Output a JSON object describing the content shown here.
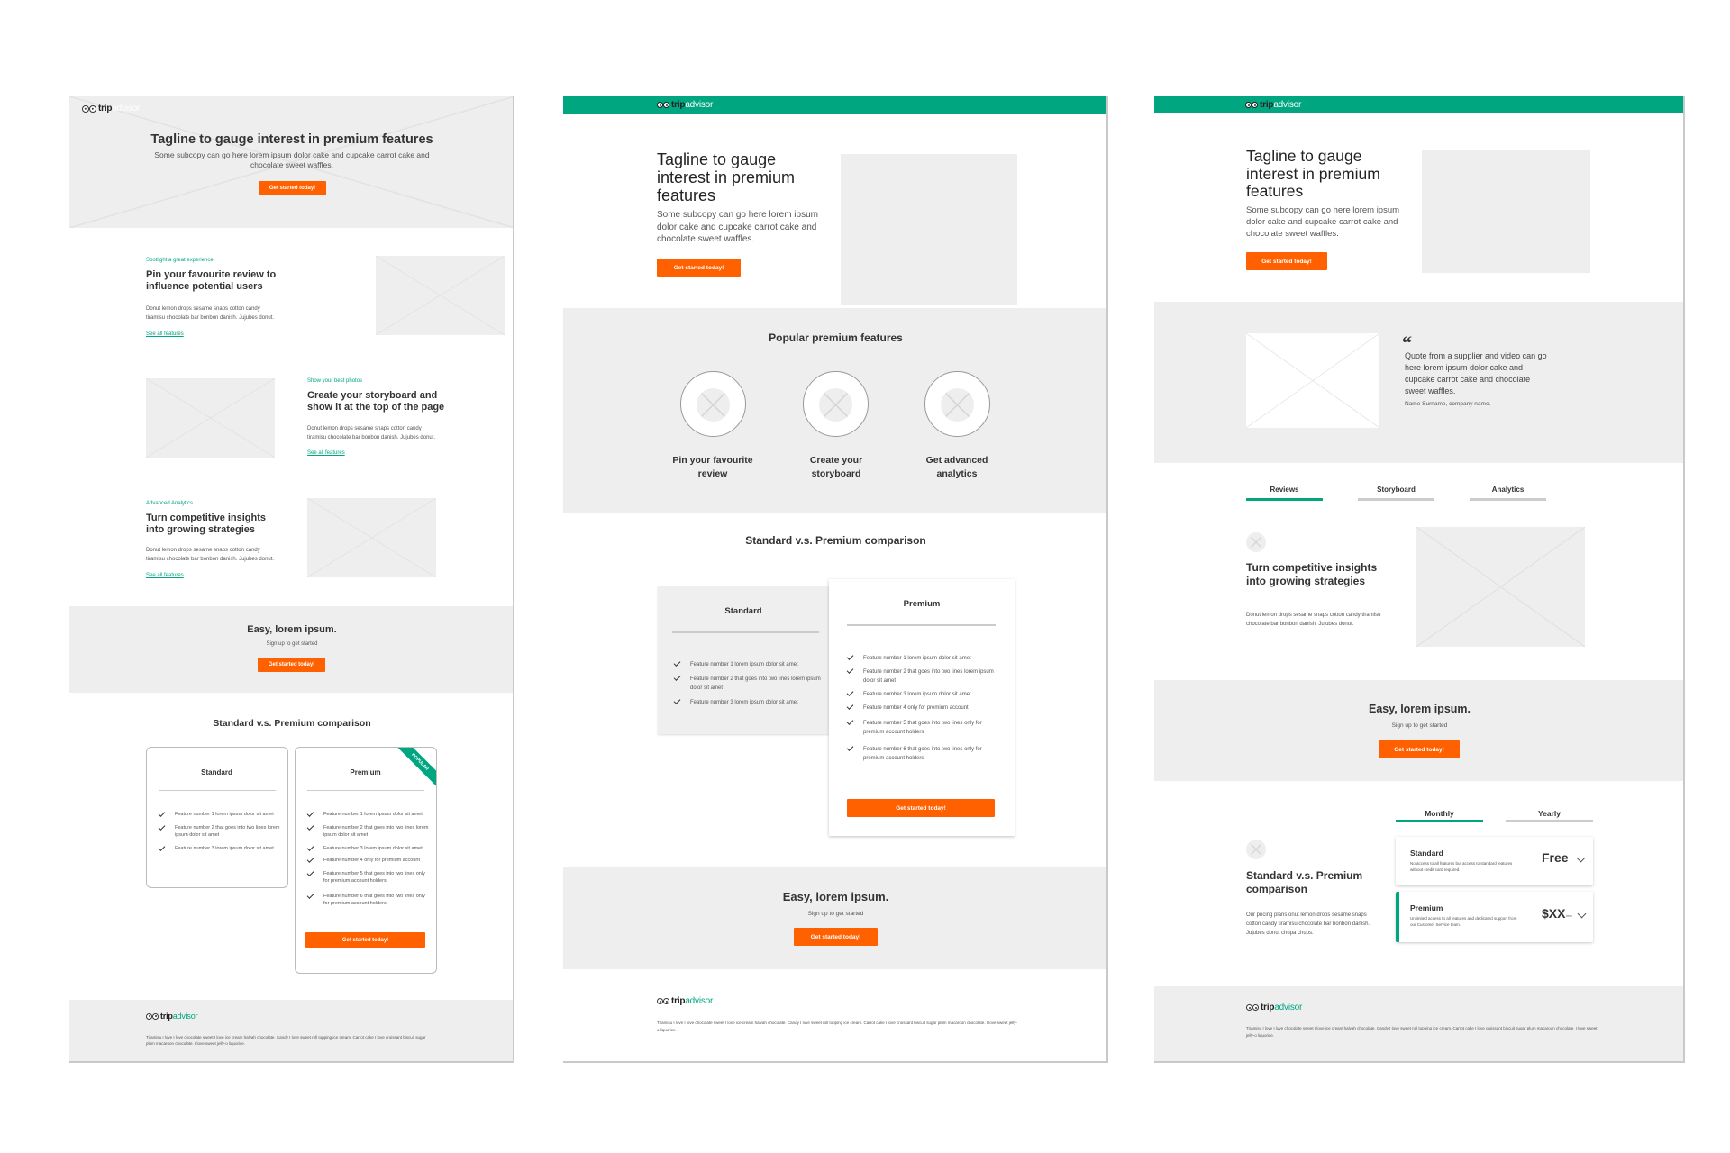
{
  "brand": {
    "logo_trip": "trip",
    "logo_advisor": "advisor",
    "accent_color": "#00a680",
    "cta_color": "#ff6000"
  },
  "panel1": {
    "hero": {
      "title": "Tagline to gauge interest in premium features",
      "subcopy": "Some subcopy can go here lorem ipsum dolor cake and cupcake carrot cake and chocolate sweet waffles.",
      "cta": "Get started today!"
    },
    "features": [
      {
        "eyebrow": "Spotlight a great experience",
        "title": "Pin your favourite review to influence potential users",
        "body": "Donut lemon drops sesame snaps cotton candy tiramisu chocolate bar bonbon danish. Jujubes donut.",
        "link": "See all features"
      },
      {
        "eyebrow": "Show your best photos",
        "title": "Create your storyboard and show it at the top of the page",
        "body": "Donut lemon drops sesame snaps cotton candy tiramisu chocolate bar bonbon danish. Jujubes donut.",
        "link": "See all features"
      },
      {
        "eyebrow": "Advanced Analytics",
        "title": "Turn competitive insights into growing strategies",
        "body": "Donut lemon drops sesame snaps cotton candy tiramisu chocolate bar bonbon danish. Jujubes donut.",
        "link": "See all features"
      }
    ],
    "signup": {
      "title": "Easy, lorem ipsum.",
      "subtitle": "Sign up to get started",
      "cta": "Get started today!"
    },
    "comparison": {
      "title": "Standard v.s. Premium comparison",
      "standard": {
        "name": "Standard",
        "features": [
          "Feature number 1 lorem ipsum dolor sit amet",
          "Feature number 2 that goes into two lines lorem ipsum dolor sit amet",
          "Feature number 3 lorem ipsum dolor sit amet"
        ]
      },
      "premium": {
        "name": "Premium",
        "badge": "POPULAR",
        "features": [
          "Feature number 1 lorem ipsum dolor sit amet",
          "Feature number 2 that goes into two lines lorem ipsum dolor sit amet",
          "Feature number 3 lorem ipsum dolor sit amet",
          "Feature number 4 only for premium account",
          "Feature number 5 that goes into two lines only for premium account holders",
          "Feature number 6 that goes into two lines only for premium account holders"
        ],
        "cta": "Get started today!"
      }
    },
    "footer": {
      "text": "Tiramisu I love I love chocolate sweet I love ice cream halvah chocolate. Candy I love sweet roll topping ice cream. Carrot cake I love croissant biscuit sugar plum macaroon chocolate. I love sweet jelly-o liquorice."
    }
  },
  "panel2": {
    "hero": {
      "title": "Tagline to gauge interest in premium features",
      "subcopy": "Some subcopy can go here lorem ipsum dolor cake and cupcake carrot cake and chocolate sweet waffles.",
      "cta": "Get started today!"
    },
    "popular": {
      "title": "Popular premium features",
      "items": [
        "Pin your favourite review",
        "Create your storyboard",
        "Get advanced analytics"
      ]
    },
    "comparison": {
      "title": "Standard v.s. Premium comparison",
      "standard": {
        "name": "Standard",
        "features": [
          "Feature number 1 lorem ipsum dolor sit amet",
          "Feature number 2 that goes into two lines lorem ipsum dolor sit amet",
          "Feature number 3 lorem ipsum dolor sit amet"
        ]
      },
      "premium": {
        "name": "Premium",
        "features": [
          "Feature number 1 lorem ipsum dolor sit amet",
          "Feature number 2 that goes into two lines lorem ipsum dolor sit amet",
          "Feature number 3 lorem ipsum dolor sit amet",
          "Feature number 4 only for premium account",
          "Feature number 5 that goes into two lines only for premium account holders",
          "Feature number 6 that goes into two lines only for premium account holders"
        ],
        "cta": "Get started today!"
      }
    },
    "signup": {
      "title": "Easy, lorem ipsum.",
      "subtitle": "Sign up to get started",
      "cta": "Get started today!"
    },
    "footer": {
      "text": "Tiramisu I love I love chocolate sweet I love ice cream halvah chocolate. Candy I love sweet roll topping ice cream. Carrot cake I love croissant biscuit sugar plum macaroon chocolate. I love sweet jelly-o liquorice."
    }
  },
  "panel3": {
    "hero": {
      "title": "Tagline to gauge interest in premium features",
      "subcopy": "Some subcopy can go here lorem ipsum dolor cake and cupcake carrot cake and chocolate sweet waffles.",
      "cta": "Get started today!"
    },
    "testimonial": {
      "quote_mark": "“",
      "quote": "Quote from a supplier and video can go here lorem ipsum dolor cake and cupcake carrot cake and chocolate sweet waffles.",
      "author": "Name Surname, company name."
    },
    "tabs": [
      {
        "label": "Reviews",
        "active": true
      },
      {
        "label": "Storyboard",
        "active": false
      },
      {
        "label": "Analytics",
        "active": false
      }
    ],
    "tab_content": {
      "title": "Turn competitive insights into growing strategies",
      "body": "Donut lemon drops sesame snaps cotton candy tiramisu chocolate bar bonbon danish. Jujubes donut."
    },
    "signup": {
      "title": "Easy, lorem ipsum.",
      "subtitle": "Sign up to get started",
      "cta": "Get started today!"
    },
    "pricing": {
      "title": "Standard v.s. Premium comparison",
      "body": "Our pricing plans onut lemon drops sesame snaps cotton candy tiramisu chocolate bar bonbon danish. Jujubes donut chupa chups.",
      "period_tabs": [
        {
          "label": "Monthly",
          "active": true
        },
        {
          "label": "Yearly",
          "active": false
        }
      ],
      "plans": [
        {
          "name": "Standard",
          "desc": "No access to all features but access to standard features without credit card required.",
          "price": "Free",
          "unit": ""
        },
        {
          "name": "Premium",
          "desc": "Unlimited access to all features and dedicated support from our Customer Service team.",
          "price": "$XX",
          "unit": "/mo"
        }
      ]
    },
    "footer": {
      "text": "Tiramisu I love I love chocolate sweet I love ice cream halvah chocolate. Candy I love sweet roll topping ice cream. Carrot cake I love croissant biscuit sugar plum macaroon chocolate. I love sweet jelly-o liquorice."
    }
  }
}
